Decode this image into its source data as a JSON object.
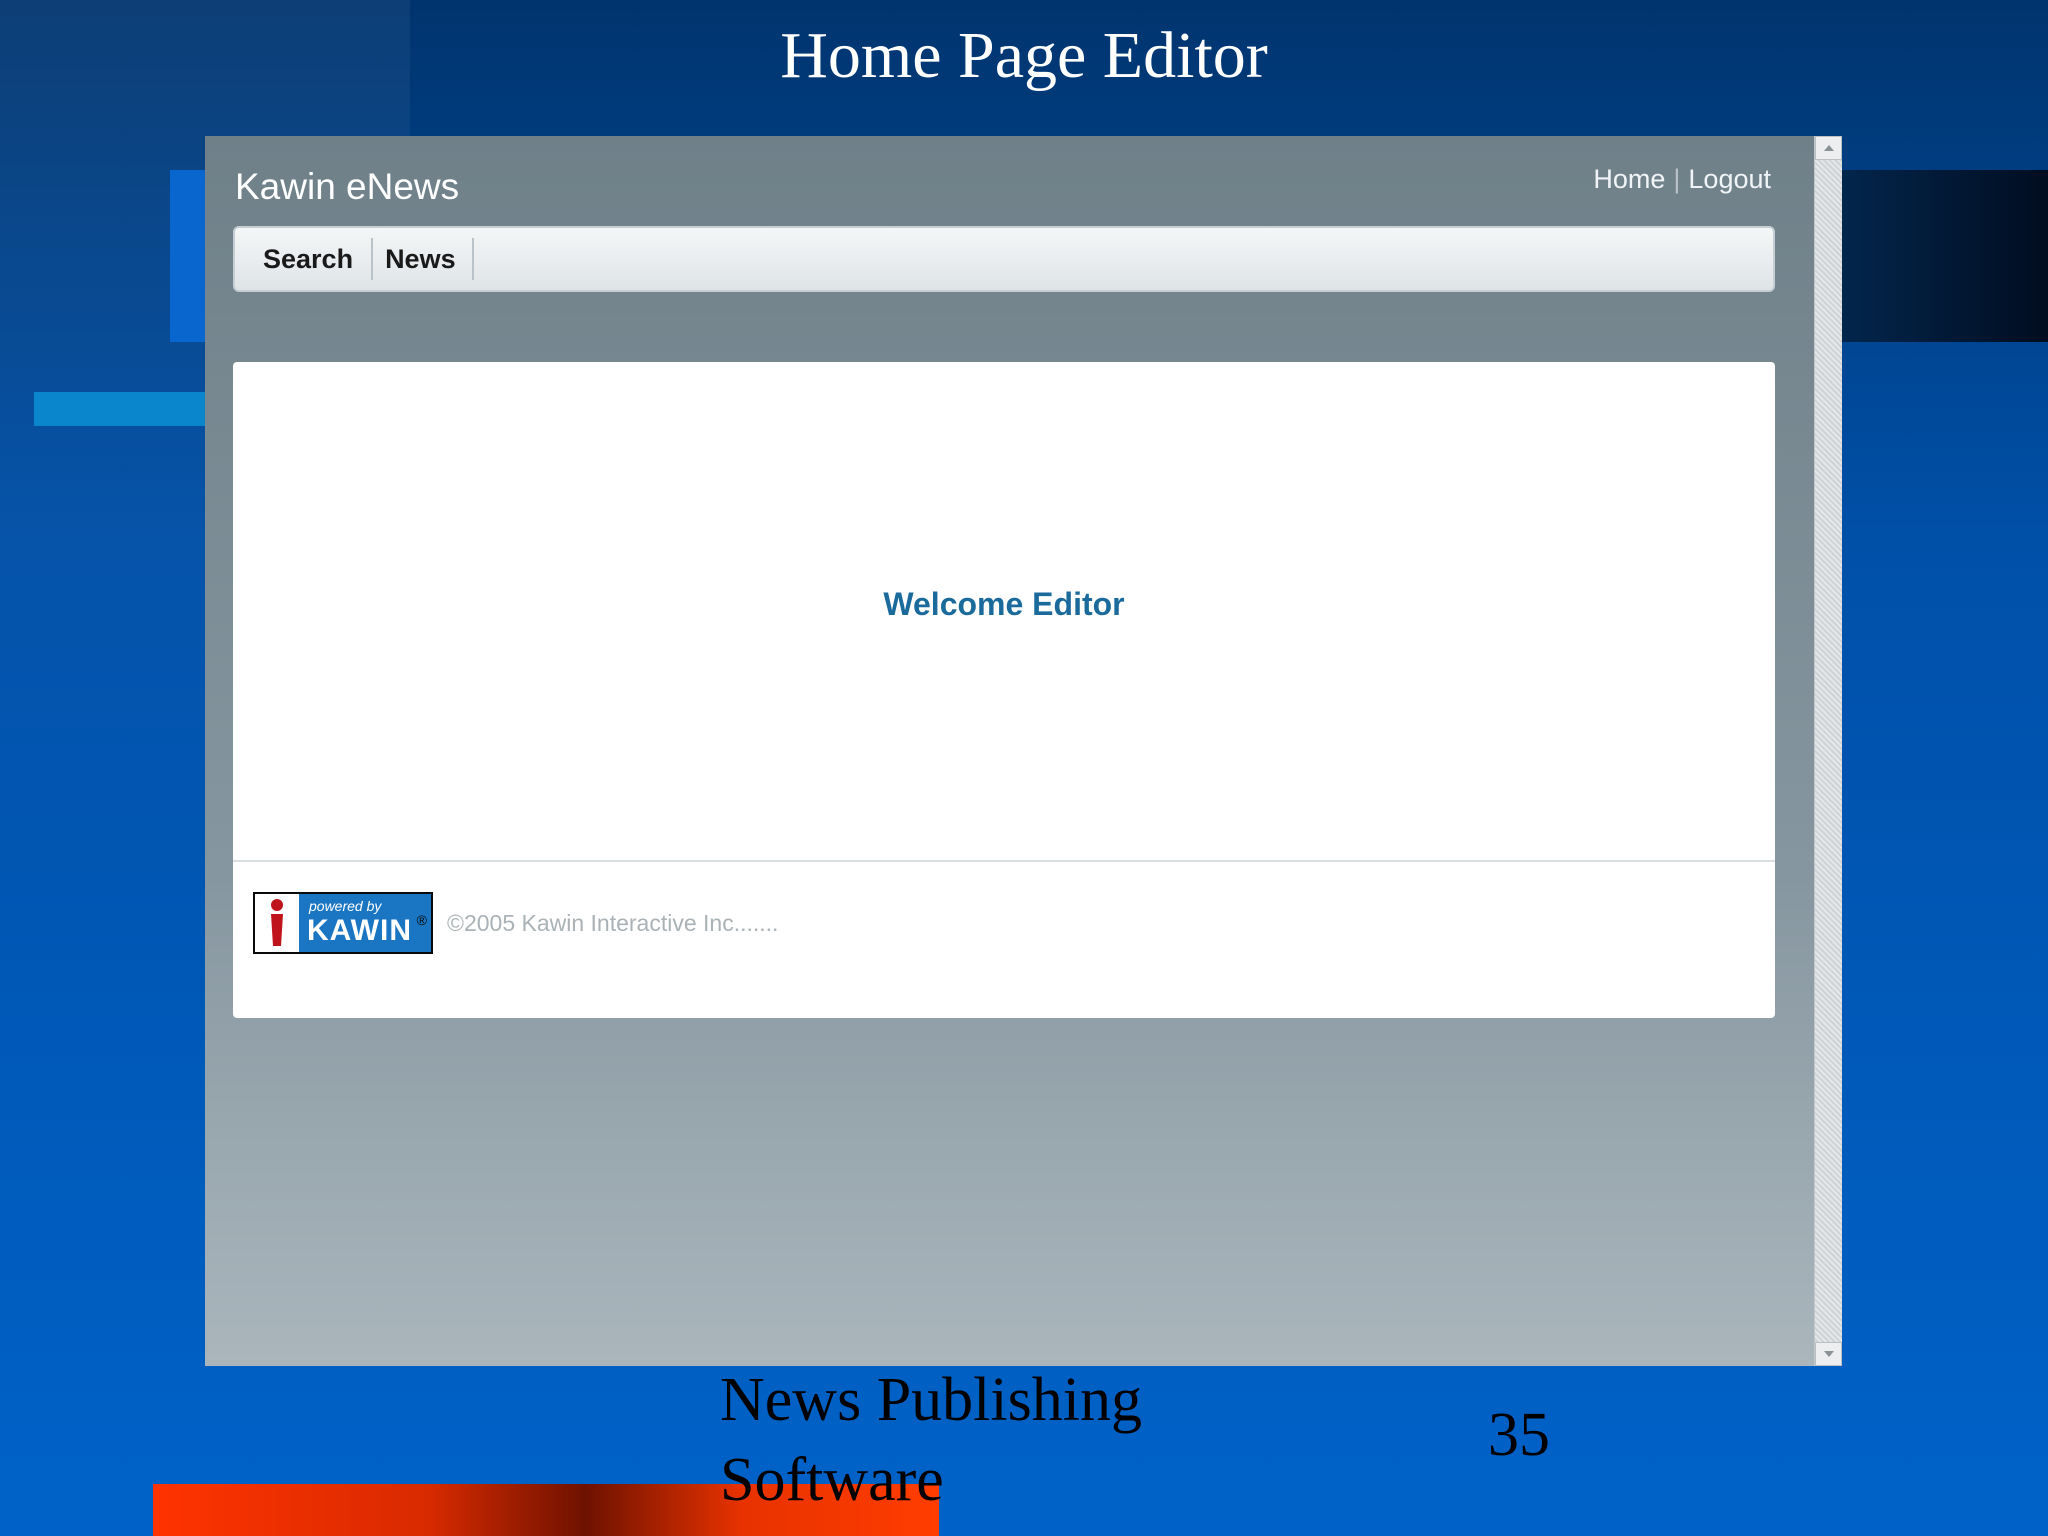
{
  "slide": {
    "title": "Home Page Editor",
    "footer_line1": "News Publishing",
    "footer_line2": "Software",
    "page_number": "35"
  },
  "app": {
    "brand": "Kawin eNews",
    "top_links": {
      "home": "Home",
      "logout": "Logout"
    },
    "nav": {
      "search": "Search",
      "news": "News"
    },
    "welcome": "Welcome Editor",
    "badge": {
      "powered": "powered by",
      "name": "KAWIN",
      "reg": "®"
    },
    "copyright": "©2005 Kawin Interactive Inc.......",
    "icons": {
      "scroll_up": "arrow-up-icon",
      "scroll_down": "arrow-down-icon",
      "logo": "kawin-i-logo"
    }
  },
  "colors": {
    "slide_bg": "#0050a8",
    "browser_bg": "#6f8089",
    "welcome_text": "#1a6a9c",
    "badge_bg": "#1a76c2"
  }
}
